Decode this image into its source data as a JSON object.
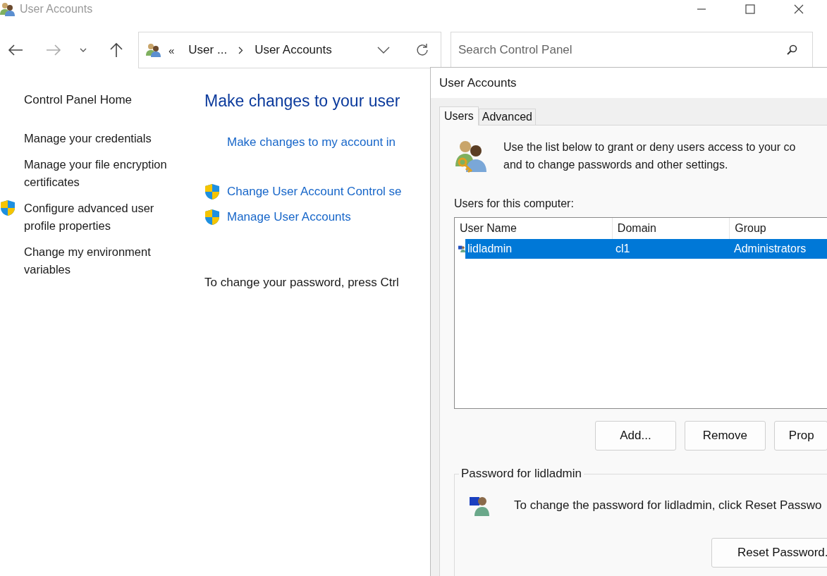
{
  "window": {
    "title": "User Accounts"
  },
  "address_bar": {
    "overflow": "«",
    "crumbs": [
      "User ...",
      "User Accounts"
    ]
  },
  "search": {
    "placeholder": "Search Control Panel"
  },
  "sidebar": {
    "home": "Control Panel Home",
    "items": [
      {
        "label": "Manage your credentials",
        "shield": false
      },
      {
        "label": "Manage your file encryption certificates",
        "shield": false
      },
      {
        "label": "Configure advanced user profile properties",
        "shield": true
      },
      {
        "label": "Change my environment variables",
        "shield": false
      }
    ]
  },
  "content": {
    "heading": "Make changes to your user",
    "links": [
      {
        "label": "Make changes to my account in",
        "shield": false
      },
      {
        "label": "Change User Account Control se",
        "shield": true
      },
      {
        "label": "Manage User Accounts",
        "shield": true
      }
    ],
    "note": "To change your password, press Ctrl"
  },
  "dialog": {
    "title": "User Accounts",
    "tabs": [
      {
        "label": "Users",
        "selected": true
      },
      {
        "label": "Advanced",
        "selected": false
      }
    ],
    "intro": [
      "Use the list below to grant or deny users access to your co",
      "and to change passwords and other settings."
    ],
    "list_label": "Users for this computer:",
    "columns": [
      "User Name",
      "Domain",
      "Group"
    ],
    "rows": [
      {
        "cells": [
          "lidladmin",
          "cl1",
          "Administrators"
        ],
        "selected": true
      }
    ],
    "buttons": [
      "Add...",
      "Remove",
      "Prop"
    ],
    "password_group": {
      "title": "Password for lidladmin",
      "text": "To change the password for lidladmin, click Reset Passwo",
      "button": "Reset Password."
    }
  }
}
